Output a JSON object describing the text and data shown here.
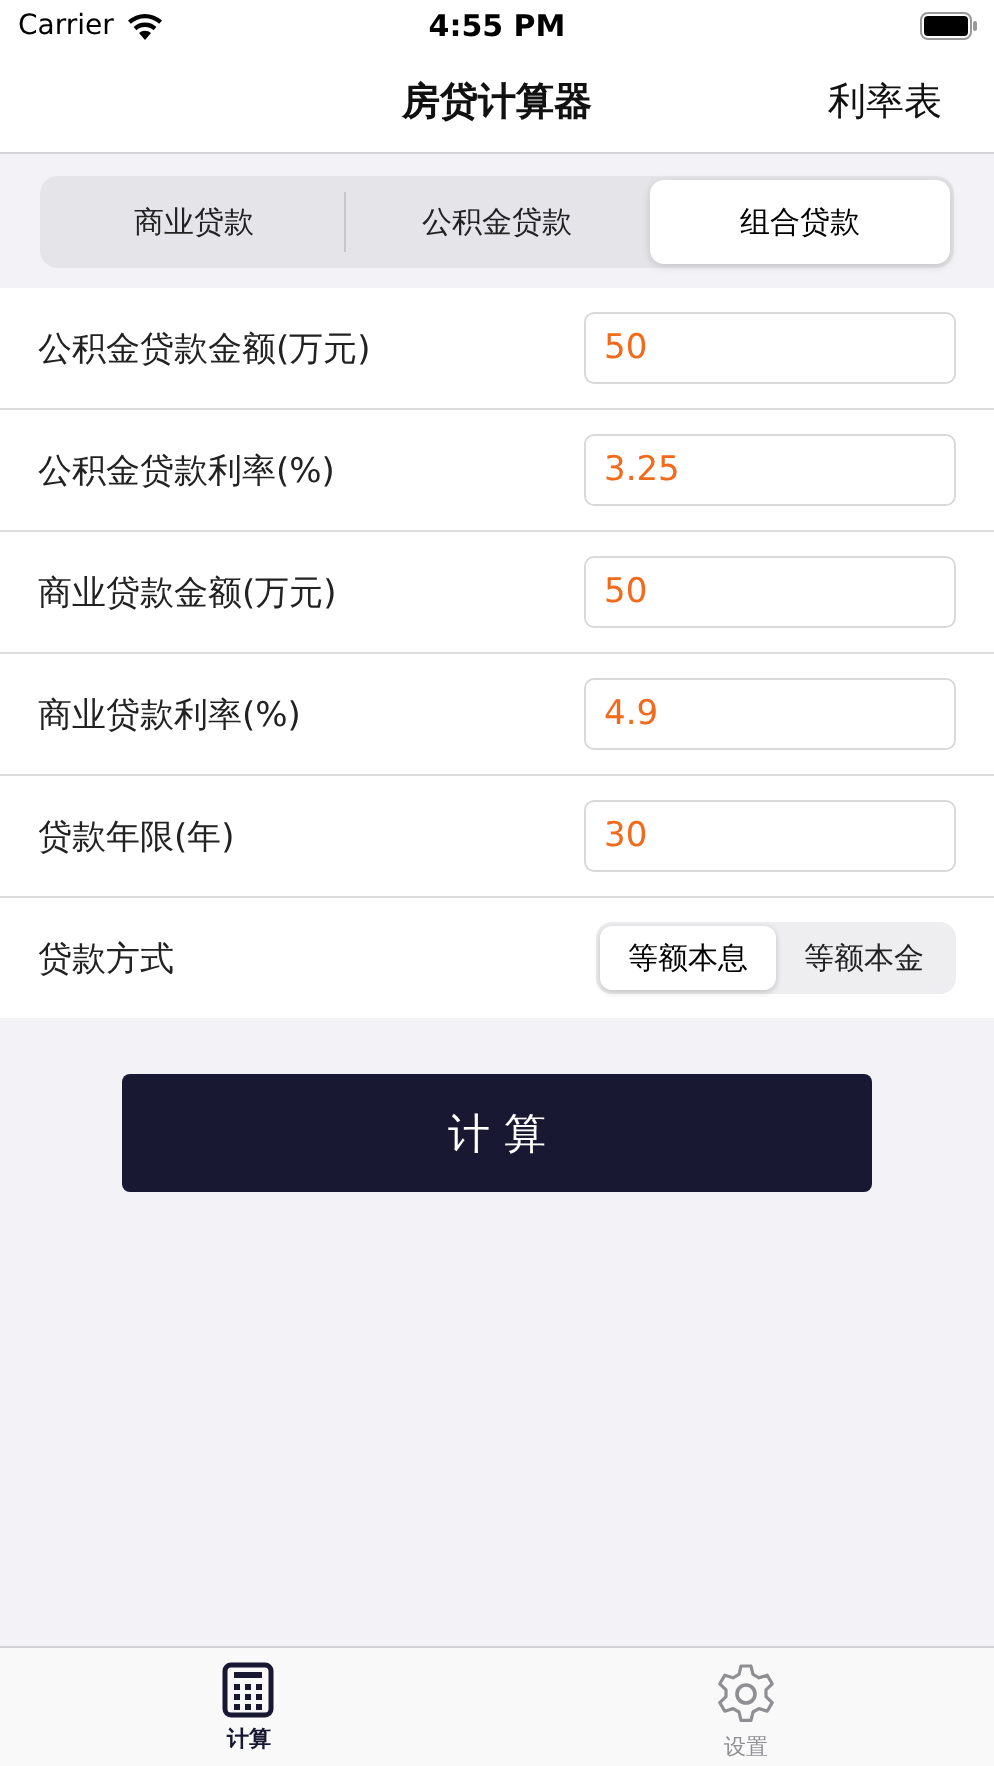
{
  "status_bar": {
    "carrier": "Carrier",
    "time": "4:55 PM"
  },
  "nav": {
    "title": "房贷计算器",
    "action": "利率表"
  },
  "loan_tabs": [
    {
      "label": "商业贷款",
      "selected": false
    },
    {
      "label": "公积金贷款",
      "selected": false
    },
    {
      "label": "组合贷款",
      "selected": true
    }
  ],
  "rows": [
    {
      "kind": "input",
      "label": "公积金贷款金额(万元)",
      "value": "50"
    },
    {
      "kind": "input",
      "label": "公积金贷款利率(%)",
      "value": "3.25"
    },
    {
      "kind": "input",
      "label": "商业贷款金额(万元)",
      "value": "50"
    },
    {
      "kind": "input",
      "label": "商业贷款利率(%)",
      "value": "4.9"
    },
    {
      "kind": "input",
      "label": "贷款年限(年)",
      "value": "30"
    },
    {
      "kind": "segmented",
      "label": "贷款方式",
      "options": [
        {
          "label": "等额本息",
          "selected": true
        },
        {
          "label": "等额本金",
          "selected": false
        }
      ]
    }
  ],
  "calculate_button": "计 算",
  "tab_bar": [
    {
      "label": "计算",
      "selected": true
    },
    {
      "label": "设置",
      "selected": false
    }
  ]
}
